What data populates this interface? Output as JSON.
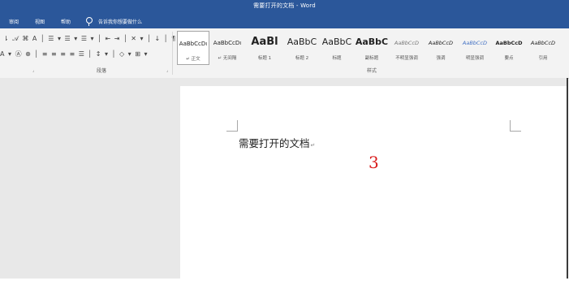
{
  "window": {
    "title": "需要打开的文档 - Word"
  },
  "menu": {
    "items": [
      "审阅",
      "视图",
      "帮助"
    ],
    "tell_me": "告诉我你想要做什么"
  },
  "ribbon": {
    "row1": "⇂ 𝒜 ⌘ A │ ☰ ▾ ☰ ▾ ☰ ▾ │ ⇤ ⇥ │ ✕ ▾ │ ↓ │ ¶",
    "row2": "A ▾ Ⓐ ⊕ │ ≡ ≡ ≡ ≡ ☰ │ ↕ ▾ │ ◇ ▾ ⊞ ▾",
    "paragraph_label": "段落",
    "styles_label": "样式",
    "styles": [
      {
        "preview": "AaBbCcDı",
        "name": "↵ 正文"
      },
      {
        "preview": "AaBbCcDı",
        "name": "↵ 无间隔"
      },
      {
        "preview": "AaBl",
        "name": "标题 1"
      },
      {
        "preview": "AaBbC",
        "name": "标题 2"
      },
      {
        "preview": "AaBbC",
        "name": "标题"
      },
      {
        "preview": "AaBbC",
        "name": "副标题"
      },
      {
        "preview": "AaBbCcD",
        "name": "不明显强调"
      },
      {
        "preview": "AaBbCcD",
        "name": "强调"
      },
      {
        "preview": "AaBbCcD",
        "name": "明显强调"
      },
      {
        "preview": "AaBbCcD",
        "name": "要点"
      },
      {
        "preview": "AaBbCcD",
        "name": "引用"
      }
    ]
  },
  "document": {
    "text": "需要打开的文档",
    "para_mark": "↵"
  },
  "annotation": {
    "number": "3"
  },
  "colors": {
    "titlebar": "#2b579a",
    "annotation": "#d91c1c"
  }
}
